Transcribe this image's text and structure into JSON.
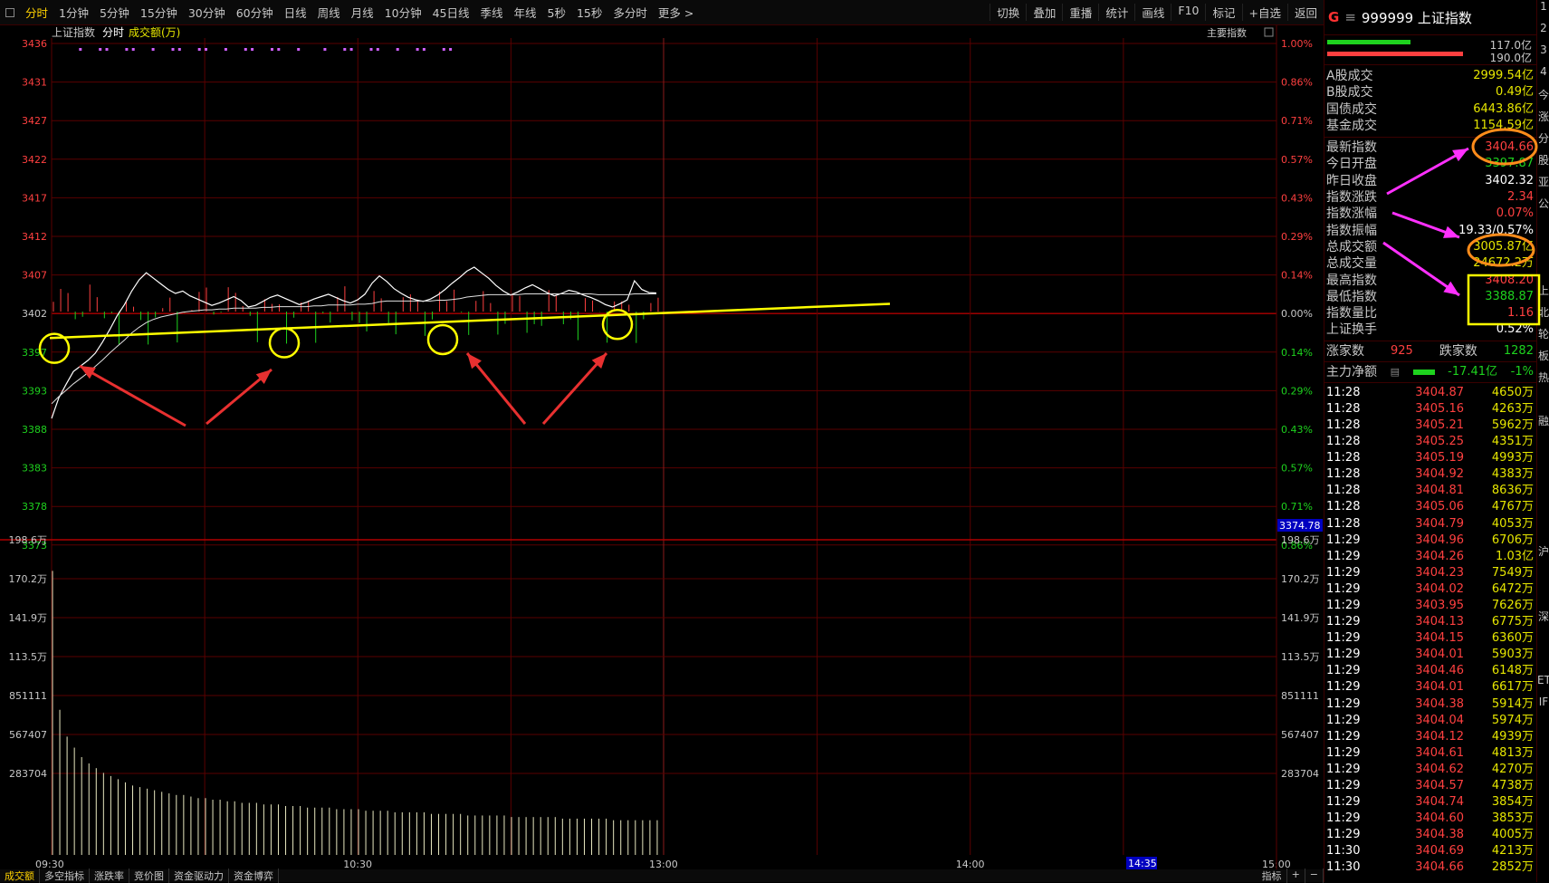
{
  "topbar": {
    "tabs": [
      "分时",
      "1分钟",
      "5分钟",
      "15分钟",
      "30分钟",
      "60分钟",
      "日线",
      "周线",
      "月线",
      "10分钟",
      "45日线",
      "季线",
      "年线",
      "5秒",
      "15秒",
      "多分时",
      "更多 >"
    ],
    "right_tabs": [
      "切换",
      "叠加",
      "重播",
      "统计",
      "画线",
      "F10",
      "标记",
      "+自选",
      "返回"
    ]
  },
  "chart_header": {
    "name": "上证指数",
    "mode": "分时",
    "indicator": "成交额(万)",
    "main_index": "主要指数"
  },
  "price_axis_left": [
    "3436",
    "3431",
    "3427",
    "3422",
    "3417",
    "3412",
    "3407",
    "3402",
    "3397",
    "3393",
    "3388",
    "3383",
    "3378",
    "3373"
  ],
  "pct_axis_right": [
    "1.00%",
    "0.86%",
    "0.71%",
    "0.57%",
    "0.43%",
    "0.29%",
    "0.14%",
    "0.00%",
    "0.14%",
    "0.29%",
    "0.43%",
    "0.57%",
    "0.71%",
    "0.86%"
  ],
  "vol_axis_left": [
    "198.6万",
    "170.2万",
    "141.9万",
    "113.5万",
    "851111",
    "567407",
    "283704"
  ],
  "vol_axis_right": [
    "198.6万",
    "170.2万",
    "141.9万",
    "113.5万",
    "851111",
    "567407",
    "283704"
  ],
  "time_labels": [
    "09:30",
    "10:30",
    "13:00",
    "14:00",
    "15:00"
  ],
  "cursor_time": "14:35",
  "cursor_price": "3374.78",
  "bottom_tabs": [
    "成交额",
    "多空指标",
    "涨跌率",
    "竞价图",
    "资金驱动力",
    "资金博弈"
  ],
  "bottom_right": [
    "指标",
    "+",
    "−"
  ],
  "panel": {
    "g": "G",
    "code": "999999 上证指数",
    "bar_vals": [
      "117.0亿",
      "190.0亿"
    ],
    "turnover": [
      {
        "label": "A股成交",
        "value": "2999.54亿"
      },
      {
        "label": "B股成交",
        "value": "0.49亿"
      },
      {
        "label": "国债成交",
        "value": "6443.86亿"
      },
      {
        "label": "基金成交",
        "value": "1154.59亿"
      }
    ],
    "stats": [
      {
        "label": "最新指数",
        "value": "3404.66",
        "color": "red"
      },
      {
        "label": "今日开盘",
        "value": "3397.87",
        "color": "green"
      },
      {
        "label": "昨日收盘",
        "value": "3402.32",
        "color": "white"
      },
      {
        "label": "指数涨跌",
        "value": "2.34",
        "color": "red"
      },
      {
        "label": "指数涨幅",
        "value": "0.07%",
        "color": "red"
      },
      {
        "label": "指数振幅",
        "value": "19.33/0.57%",
        "color": "white"
      },
      {
        "label": "总成交额",
        "value": "3005.87亿",
        "color": "yellow"
      },
      {
        "label": "总成交量",
        "value": "24672.2万",
        "color": "yellow"
      },
      {
        "label": "最高指数",
        "value": "3408.20",
        "color": "red"
      },
      {
        "label": "最低指数",
        "value": "3388.87",
        "color": "green"
      },
      {
        "label": "指数量比",
        "value": "1.16",
        "color": "red"
      },
      {
        "label": "上证换手",
        "value": "0.52%",
        "color": "white"
      }
    ],
    "up_label": "涨家数",
    "up": "925",
    "down_label": "跌家数",
    "down": "1282",
    "flow_label": "主力净额",
    "flow": "-17.41亿",
    "flow_pct": "-1%",
    "ticks": [
      [
        "11:28",
        "3404.87",
        "4650万"
      ],
      [
        "11:28",
        "3405.16",
        "4263万"
      ],
      [
        "11:28",
        "3405.21",
        "5962万"
      ],
      [
        "11:28",
        "3405.25",
        "4351万"
      ],
      [
        "11:28",
        "3405.19",
        "4993万"
      ],
      [
        "11:28",
        "3404.92",
        "4383万"
      ],
      [
        "11:28",
        "3404.81",
        "8636万"
      ],
      [
        "11:28",
        "3405.06",
        "4767万"
      ],
      [
        "11:28",
        "3404.79",
        "4053万"
      ],
      [
        "11:29",
        "3404.96",
        "6706万"
      ],
      [
        "11:29",
        "3404.26",
        "1.03亿"
      ],
      [
        "11:29",
        "3404.23",
        "7549万"
      ],
      [
        "11:29",
        "3404.02",
        "6472万"
      ],
      [
        "11:29",
        "3403.95",
        "7626万"
      ],
      [
        "11:29",
        "3404.13",
        "6775万"
      ],
      [
        "11:29",
        "3404.15",
        "6360万"
      ],
      [
        "11:29",
        "3404.01",
        "5903万"
      ],
      [
        "11:29",
        "3404.46",
        "6148万"
      ],
      [
        "11:29",
        "3404.01",
        "6617万"
      ],
      [
        "11:29",
        "3404.38",
        "5914万"
      ],
      [
        "11:29",
        "3404.04",
        "5974万"
      ],
      [
        "11:29",
        "3404.12",
        "4939万"
      ],
      [
        "11:29",
        "3404.61",
        "4813万"
      ],
      [
        "11:29",
        "3404.62",
        "4270万"
      ],
      [
        "11:29",
        "3404.57",
        "4738万"
      ],
      [
        "11:29",
        "3404.74",
        "3854万"
      ],
      [
        "11:29",
        "3404.60",
        "3853万"
      ],
      [
        "11:29",
        "3404.38",
        "4005万"
      ],
      [
        "11:30",
        "3404.69",
        "4213万"
      ],
      [
        "11:30",
        "3404.66",
        "2852万"
      ]
    ]
  },
  "side_strip": [
    "1",
    "2",
    "3",
    "4",
    "今",
    "涨",
    "分",
    "股",
    "亚",
    "公",
    "",
    "",
    "",
    "上",
    "北",
    "轮",
    "板",
    "热",
    "",
    "融",
    "",
    "",
    "",
    "",
    "",
    "沪",
    "",
    "",
    "深",
    "",
    "",
    "ET",
    "IF"
  ],
  "colors": {
    "up": "#ff4040",
    "down": "#1ed21e",
    "grid": "#5a0000",
    "price_line": "#ffffff",
    "avg_line": "#e6e600",
    "trend": "#ffff00",
    "circle": "#ffff00",
    "arrow_red": "#e83030",
    "arrow_magenta": "#ff30ff",
    "highlight_orange": "#ff8c1a"
  },
  "chart_data": {
    "type": "line",
    "prev_close": 3402.32,
    "ylim": [
      3368,
      3436
    ],
    "price_series": [
      3388.9,
      3391.5,
      3393.2,
      3394.8,
      3395.5,
      3396.2,
      3397.1,
      3398.5,
      3400.1,
      3401.8,
      3403.2,
      3404.9,
      3406.3,
      3407.2,
      3406.5,
      3405.8,
      3405.1,
      3404.6,
      3404.9,
      3404.3,
      3403.9,
      3403.5,
      3403.1,
      3403.4,
      3403.8,
      3404.2,
      3403.7,
      3402.9,
      3403.1,
      3403.6,
      3404.1,
      3404.4,
      3404.0,
      3403.6,
      3403.2,
      3403.5,
      3403.9,
      3404.2,
      3404.5,
      3404.1,
      3403.7,
      3403.4,
      3403.8,
      3404.5,
      3405.9,
      3406.8,
      3406.1,
      3405.2,
      3404.6,
      3404.1,
      3403.8,
      3403.6,
      3403.9,
      3404.4,
      3405.1,
      3405.9,
      3406.6,
      3407.4,
      3407.9,
      3407.2,
      3406.5,
      3405.6,
      3404.9,
      3404.4,
      3404.8,
      3405.3,
      3405.7,
      3405.2,
      3404.7,
      3404.3,
      3404.6,
      3405.0,
      3404.8,
      3404.4,
      3404.1,
      3403.7,
      3403.2,
      3402.9,
      3403.3,
      3403.8,
      3406.2,
      3405.1,
      3404.7,
      3404.66
    ],
    "avg_series": [
      3391.2,
      3392.1,
      3392.9,
      3393.7,
      3394.4,
      3395.1,
      3395.9,
      3396.7,
      3397.6,
      3398.4,
      3399.2,
      3400.1,
      3400.8,
      3401.4,
      3401.8,
      3402.1,
      3402.3,
      3402.5,
      3402.7,
      3402.8,
      3402.9,
      3403.0,
      3403.0,
      3403.1,
      3403.1,
      3403.2,
      3403.2,
      3403.2,
      3403.2,
      3403.3,
      3403.3,
      3403.4,
      3403.4,
      3403.4,
      3403.4,
      3403.4,
      3403.5,
      3403.5,
      3403.6,
      3403.6,
      3403.6,
      3403.6,
      3403.7,
      3403.7,
      3403.8,
      3404.0,
      3404.1,
      3404.1,
      3404.1,
      3404.1,
      3404.1,
      3404.1,
      3404.1,
      3404.2,
      3404.2,
      3404.3,
      3404.4,
      3404.6,
      3404.7,
      3404.8,
      3404.9,
      3404.9,
      3404.9,
      3404.9,
      3404.9,
      3405.0,
      3405.0,
      3405.0,
      3405.0,
      3405.0,
      3405.0,
      3405.0,
      3405.0,
      3405.0,
      3405.0,
      3404.9,
      3404.9,
      3404.9,
      3404.9,
      3404.9,
      3405.0,
      3405.0,
      3405.0,
      3405.0
    ],
    "volume_series": [
      180,
      92,
      75,
      68,
      62,
      58,
      55,
      52,
      50,
      48,
      46,
      44,
      43,
      42,
      41,
      40,
      39,
      38,
      38,
      37,
      36,
      36,
      35,
      35,
      34,
      34,
      33,
      33,
      33,
      32,
      32,
      32,
      31,
      31,
      31,
      30,
      30,
      30,
      30,
      29,
      29,
      29,
      29,
      28,
      28,
      28,
      28,
      27,
      27,
      27,
      27,
      27,
      26,
      26,
      26,
      26,
      26,
      25,
      25,
      25,
      25,
      25,
      25,
      24,
      24,
      24,
      24,
      24,
      24,
      24,
      23,
      23,
      23,
      23,
      23,
      23,
      23,
      22,
      22,
      22,
      22,
      22,
      22,
      22
    ],
    "vol_ylim": [
      0,
      198.6
    ],
    "vol_unit": "万"
  }
}
